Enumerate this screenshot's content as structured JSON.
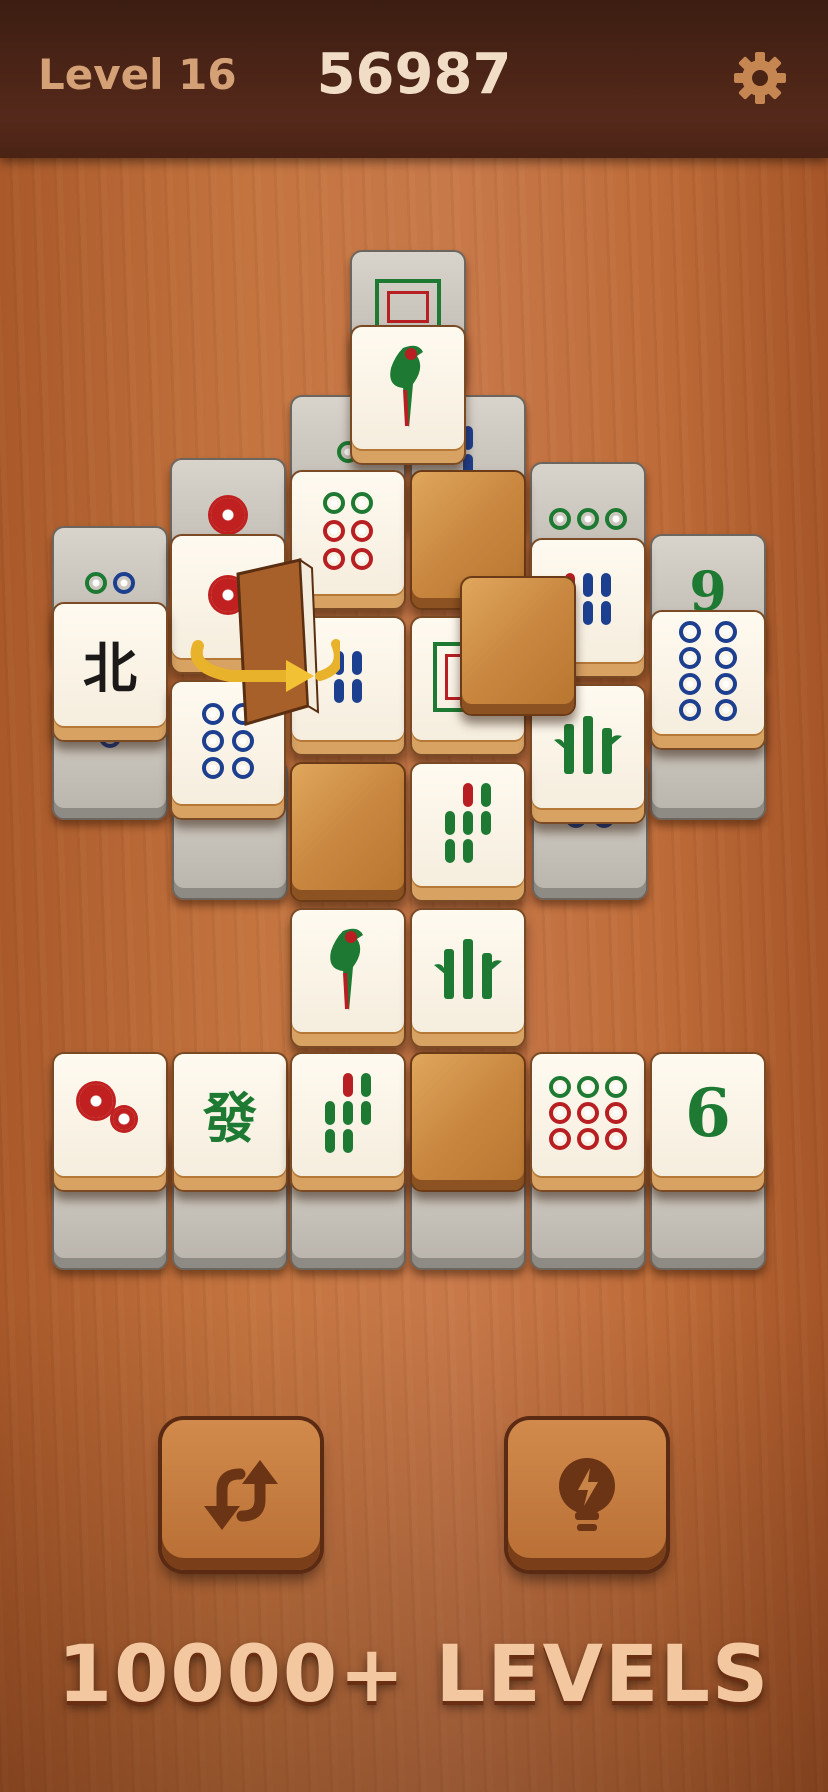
{
  "header": {
    "level_label": "Level 16",
    "score": "56987"
  },
  "icons": {
    "settings": "gear-icon",
    "shuffle": "shuffle-icon",
    "hint": "lightbulb-icon",
    "flip": "flip-arrow-icon"
  },
  "tiles": {
    "north": "北",
    "green_dragon": "發",
    "six": "6",
    "nine": "9"
  },
  "footer": {
    "banner": "10000+ LEVELS"
  }
}
